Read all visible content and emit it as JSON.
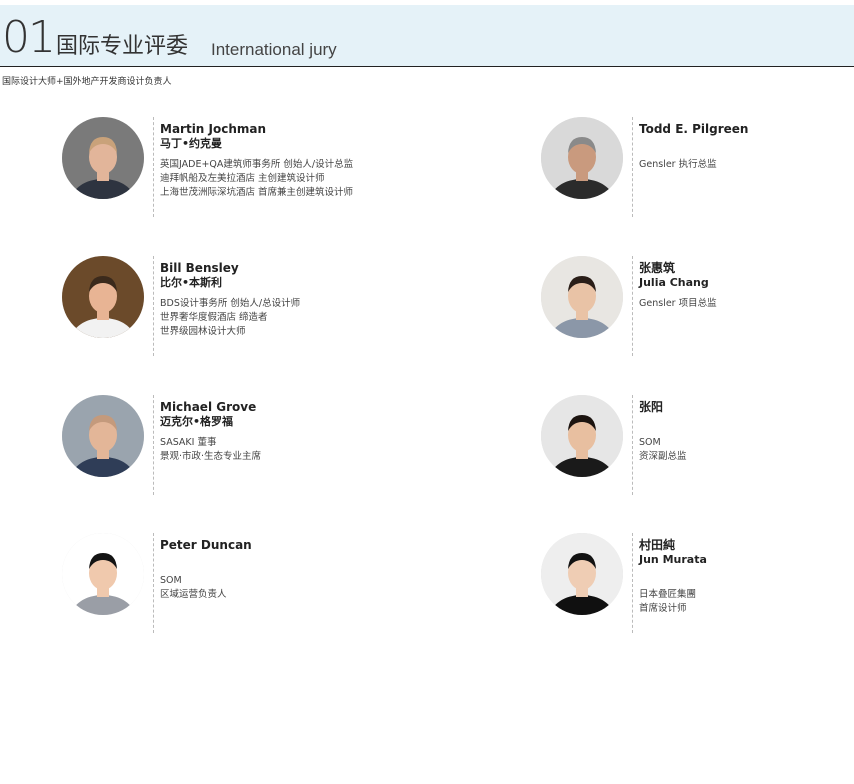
{
  "header": {
    "number": "01",
    "title_cn": "国际专业评委",
    "title_en": "International jury"
  },
  "subtitle": "国际设计大师+国外地产开发商设计负责人",
  "jurors": [
    {
      "name_primary": "Martin Jochman",
      "name_secondary": "马丁•约克曼",
      "desc": [
        "英国JADE+QA建筑师事务所 创始人/设计总监",
        "迪拜帆船及左美拉酒店 主创建筑设计师",
        "上海世茂洲际深坑酒店 首席兼主创建筑设计师"
      ],
      "portrait": {
        "bg": "#7a7a7a",
        "skin": "#e2b59a",
        "hair": "#c9a27a",
        "cloth": "#2e3440"
      }
    },
    {
      "name_primary": "Todd E. Pilgreen",
      "name_secondary": "",
      "desc": [
        "Gensler 执行总监"
      ],
      "portrait": {
        "bg": "#d9d9d9",
        "skin": "#c99a7e",
        "hair": "#8a8a8a",
        "cloth": "#2b2b2b"
      }
    },
    {
      "name_primary": "Bill Bensley",
      "name_secondary": "比尔•本斯利",
      "desc": [
        "BDS设计事务所 创始人/总设计师",
        "世界奢华度假酒店 缔造者",
        "世界级园林设计大师"
      ],
      "portrait": {
        "bg": "#6b4a2a",
        "skin": "#e8b494",
        "hair": "#3b2a1c",
        "cloth": "#f2f2f2"
      }
    },
    {
      "name_primary": "张惠筑",
      "name_secondary": "Julia Chang",
      "desc": [
        "Gensler 项目总监"
      ],
      "portrait": {
        "bg": "#e8e6e2",
        "skin": "#e9c3a6",
        "hair": "#2a1e18",
        "cloth": "#8b97a8"
      }
    },
    {
      "name_primary": "Michael Grove",
      "name_secondary": "迈克尔•格罗福",
      "desc": [
        "SASAKI 董事",
        "景观·市政·生态专业主席"
      ],
      "portrait": {
        "bg": "#9aa4ae",
        "skin": "#e3b698",
        "hair": "#c49a7c",
        "cloth": "#2f3d57"
      }
    },
    {
      "name_primary": "张阳",
      "name_secondary": "",
      "desc": [
        "SOM",
        "资深副总监"
      ],
      "portrait": {
        "bg": "#e6e6e6",
        "skin": "#e8bfa0",
        "hair": "#1c1410",
        "cloth": "#1a1a1a"
      }
    },
    {
      "name_primary": "Peter Duncan",
      "name_secondary": "",
      "desc": [
        "SOM",
        "区域运营负责人"
      ],
      "portrait": {
        "bg": "#ffffff",
        "skin": "#f0c9ad",
        "hair": "#141414",
        "cloth": "#9a9ea6"
      }
    },
    {
      "name_primary": "村田純",
      "name_secondary": "Jun Murata",
      "desc": [
        "",
        "日本叠匠集團",
        "首席设计师"
      ],
      "portrait": {
        "bg": "#eeeeee",
        "skin": "#efcdb4",
        "hair": "#121212",
        "cloth": "#101010"
      }
    }
  ]
}
